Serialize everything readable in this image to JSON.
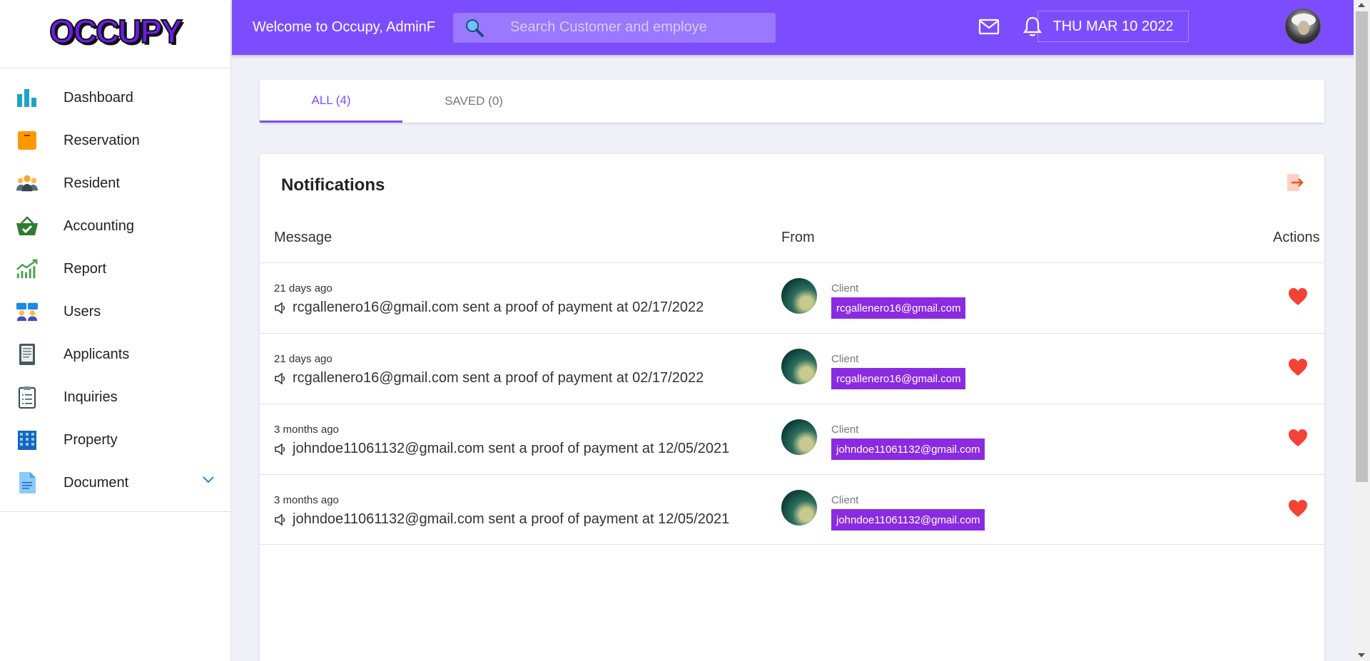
{
  "brand": {
    "logo_text": "OCCUPY"
  },
  "sidebar": {
    "items": [
      {
        "label": "Dashboard",
        "icon": "bar-chart-icon"
      },
      {
        "label": "Reservation",
        "icon": "reservation-icon"
      },
      {
        "label": "Resident",
        "icon": "people-group-icon"
      },
      {
        "label": "Accounting",
        "icon": "basket-check-icon"
      },
      {
        "label": "Report",
        "icon": "trend-chart-icon"
      },
      {
        "label": "Users",
        "icon": "users-icon"
      },
      {
        "label": "Applicants",
        "icon": "ebook-icon"
      },
      {
        "label": "Inquiries",
        "icon": "clipboard-icon"
      },
      {
        "label": "Property",
        "icon": "building-icon"
      },
      {
        "label": "Document",
        "icon": "document-icon"
      }
    ]
  },
  "header": {
    "welcome": "Welcome to Occupy, AdminF",
    "search_placeholder": "Search Customer and employe",
    "date": "THU MAR 10 2022"
  },
  "tabs": [
    {
      "label": "ALL (4)",
      "active": true
    },
    {
      "label": "SAVED (0)",
      "active": false
    }
  ],
  "notifications": {
    "title": "Notifications",
    "columns": {
      "message": "Message",
      "from": "From",
      "actions": "Actions"
    },
    "rows": [
      {
        "time": "21 days ago",
        "message": "rcgallenero16@gmail.com sent a proof of payment at 02/17/2022",
        "role": "Client",
        "email": "rcgallenero16@gmail.com"
      },
      {
        "time": "21 days ago",
        "message": "rcgallenero16@gmail.com sent a proof of payment at 02/17/2022",
        "role": "Client",
        "email": "rcgallenero16@gmail.com"
      },
      {
        "time": "3 months ago",
        "message": "johndoe11061132@gmail.com sent a proof of payment at 12/05/2021",
        "role": "Client",
        "email": "johndoe11061132@gmail.com"
      },
      {
        "time": "3 months ago",
        "message": "johndoe11061132@gmail.com sent a proof of payment at 12/05/2021",
        "role": "Client",
        "email": "johndoe11061132@gmail.com"
      }
    ]
  },
  "colors": {
    "primary": "#7c4dff",
    "badge": "#8a2be2",
    "heart": "#f44336"
  }
}
